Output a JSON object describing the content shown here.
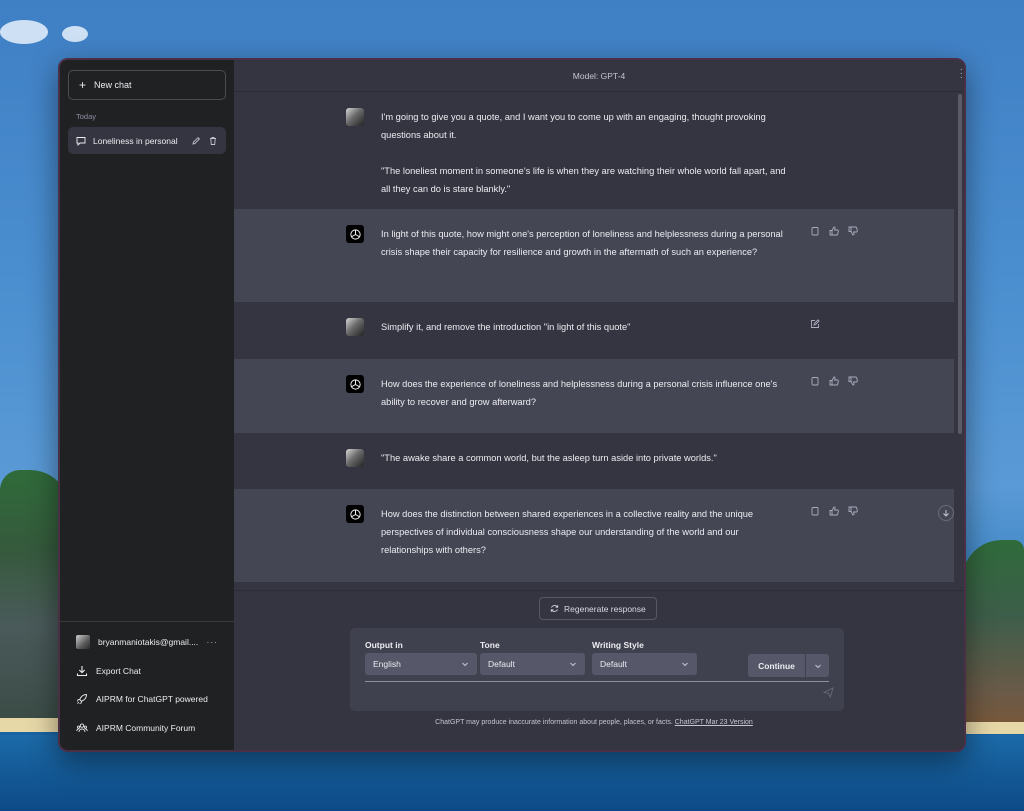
{
  "sidebar": {
    "new_chat_label": "New chat",
    "section_today": "Today",
    "active_chat_label": "Loneliness in personal",
    "account_email": "bryanmaniotakis@gmail....",
    "account_menu": "···",
    "bottom_items": [
      {
        "label": "Export Chat",
        "icon": "download-icon"
      },
      {
        "label": "AIPRM for ChatGPT powered",
        "icon": "rocket-icon"
      },
      {
        "label": "AIPRM Community Forum",
        "icon": "community-icon"
      }
    ]
  },
  "header": {
    "model_label": "Model: GPT-4"
  },
  "messages": [
    {
      "role": "user",
      "text": "I'm going to give you a quote, and I want you to come up with an engaging, thought provoking questions about it.\n\n\"The loneliest moment in someone's life is when they are watching their whole world fall apart, and all they can do is stare blankly.\""
    },
    {
      "role": "assistant",
      "text": "In light of this quote, how might one's perception of loneliness and helplessness during a personal crisis shape their capacity for resilience and growth in the aftermath of such an experience?"
    },
    {
      "role": "user",
      "text": "Simplify it, and remove the introduction \"in light of this quote\""
    },
    {
      "role": "assistant",
      "text": "How does the experience of loneliness and helplessness during a personal crisis influence one's ability to recover and grow afterward?"
    },
    {
      "role": "user",
      "text": "\"The awake share a common world, but the asleep turn aside into private worlds.\""
    },
    {
      "role": "assistant",
      "text": "How does the distinction between shared experiences in a collective reality and the unique perspectives of individual consciousness shape our understanding of the world and our relationships with others?"
    }
  ],
  "composer": {
    "regenerate_label": "Regenerate response",
    "output_label": "Output in",
    "output_value": "English",
    "tone_label": "Tone",
    "tone_value": "Default",
    "style_label": "Writing Style",
    "style_value": "Default",
    "continue_label": "Continue",
    "disclaimer": "ChatGPT may produce inaccurate information about people, places, or facts.",
    "version_link": "ChatGPT Mar 23 Version"
  },
  "colors": {
    "sidebar_bg": "#202123",
    "main_bg": "#343541",
    "assistant_bg": "#444654",
    "input_bg": "#40414f"
  }
}
